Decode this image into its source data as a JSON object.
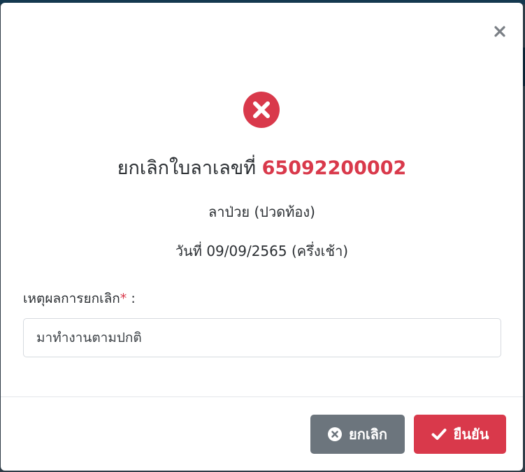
{
  "dialog": {
    "title_prefix": "ยกเลิกใบลาเลขที่",
    "document_number": "65092200002",
    "leave_type": "ลาป่วย (ปวดท้อง)",
    "leave_date": "วันที่ 09/09/2565 (ครึ่งเช้า)",
    "reason": {
      "label": "เหตุผลการยกเลิก",
      "required_mark": "*",
      "separator": " :",
      "value": "มาทำงานตามปกติ"
    },
    "buttons": {
      "cancel_label": "ยกเลิก",
      "confirm_label": "ยืนยัน"
    }
  },
  "icons": {
    "close": "close-icon",
    "header": "error-circle-icon",
    "cancel": "times-circle-icon",
    "confirm": "check-icon"
  },
  "colors": {
    "danger": "#d9394b",
    "secondary": "#6c757d",
    "text": "#2b2f33"
  }
}
